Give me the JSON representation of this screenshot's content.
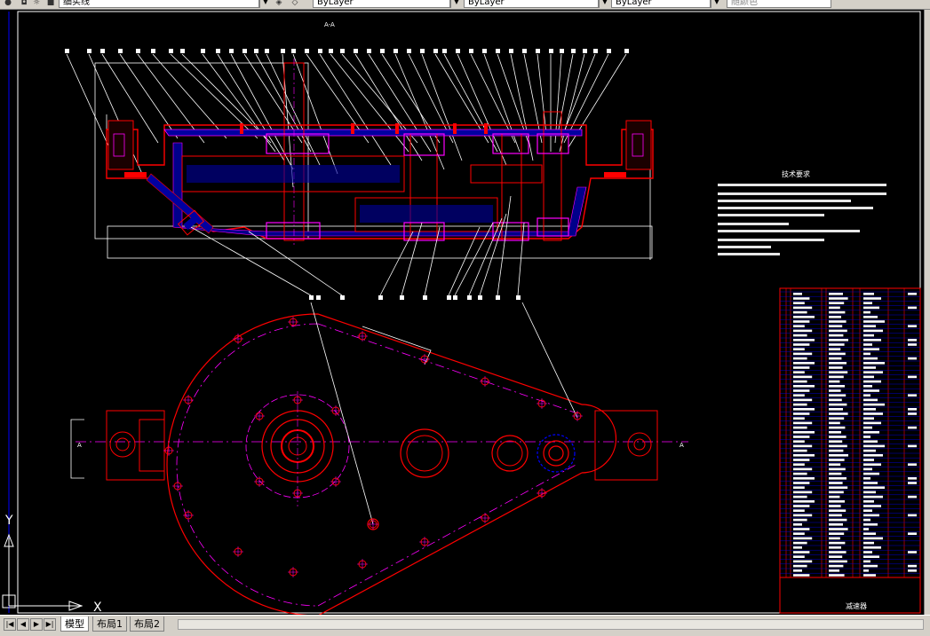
{
  "toolbar": {
    "layer_value": "细实线",
    "color_value": "ByLayer",
    "linetype_value": "ByLayer",
    "lineweight_value": "ByLayer",
    "plotstyle_value": "随颜色"
  },
  "drawing": {
    "section_label": "A-A",
    "view_label_left": "A",
    "view_label_right": "A",
    "tech_req_title": "技术要求",
    "title_block_name": "减速器"
  },
  "ucs": {
    "y_label": "Y",
    "x_label": "X"
  },
  "tabs": [
    {
      "label": "模型",
      "active": true
    },
    {
      "label": "布局1",
      "active": false
    },
    {
      "label": "布局2",
      "active": false
    }
  ],
  "nav": {
    "first": "|◀",
    "prev": "◀",
    "next": "▶",
    "last": "▶|"
  },
  "colors": {
    "background": "#000000",
    "outline": "#ff0000",
    "centerline": "#ff00ff",
    "leader": "#ffffff",
    "hatch": "#0000ff",
    "frame": "#ffffff"
  }
}
